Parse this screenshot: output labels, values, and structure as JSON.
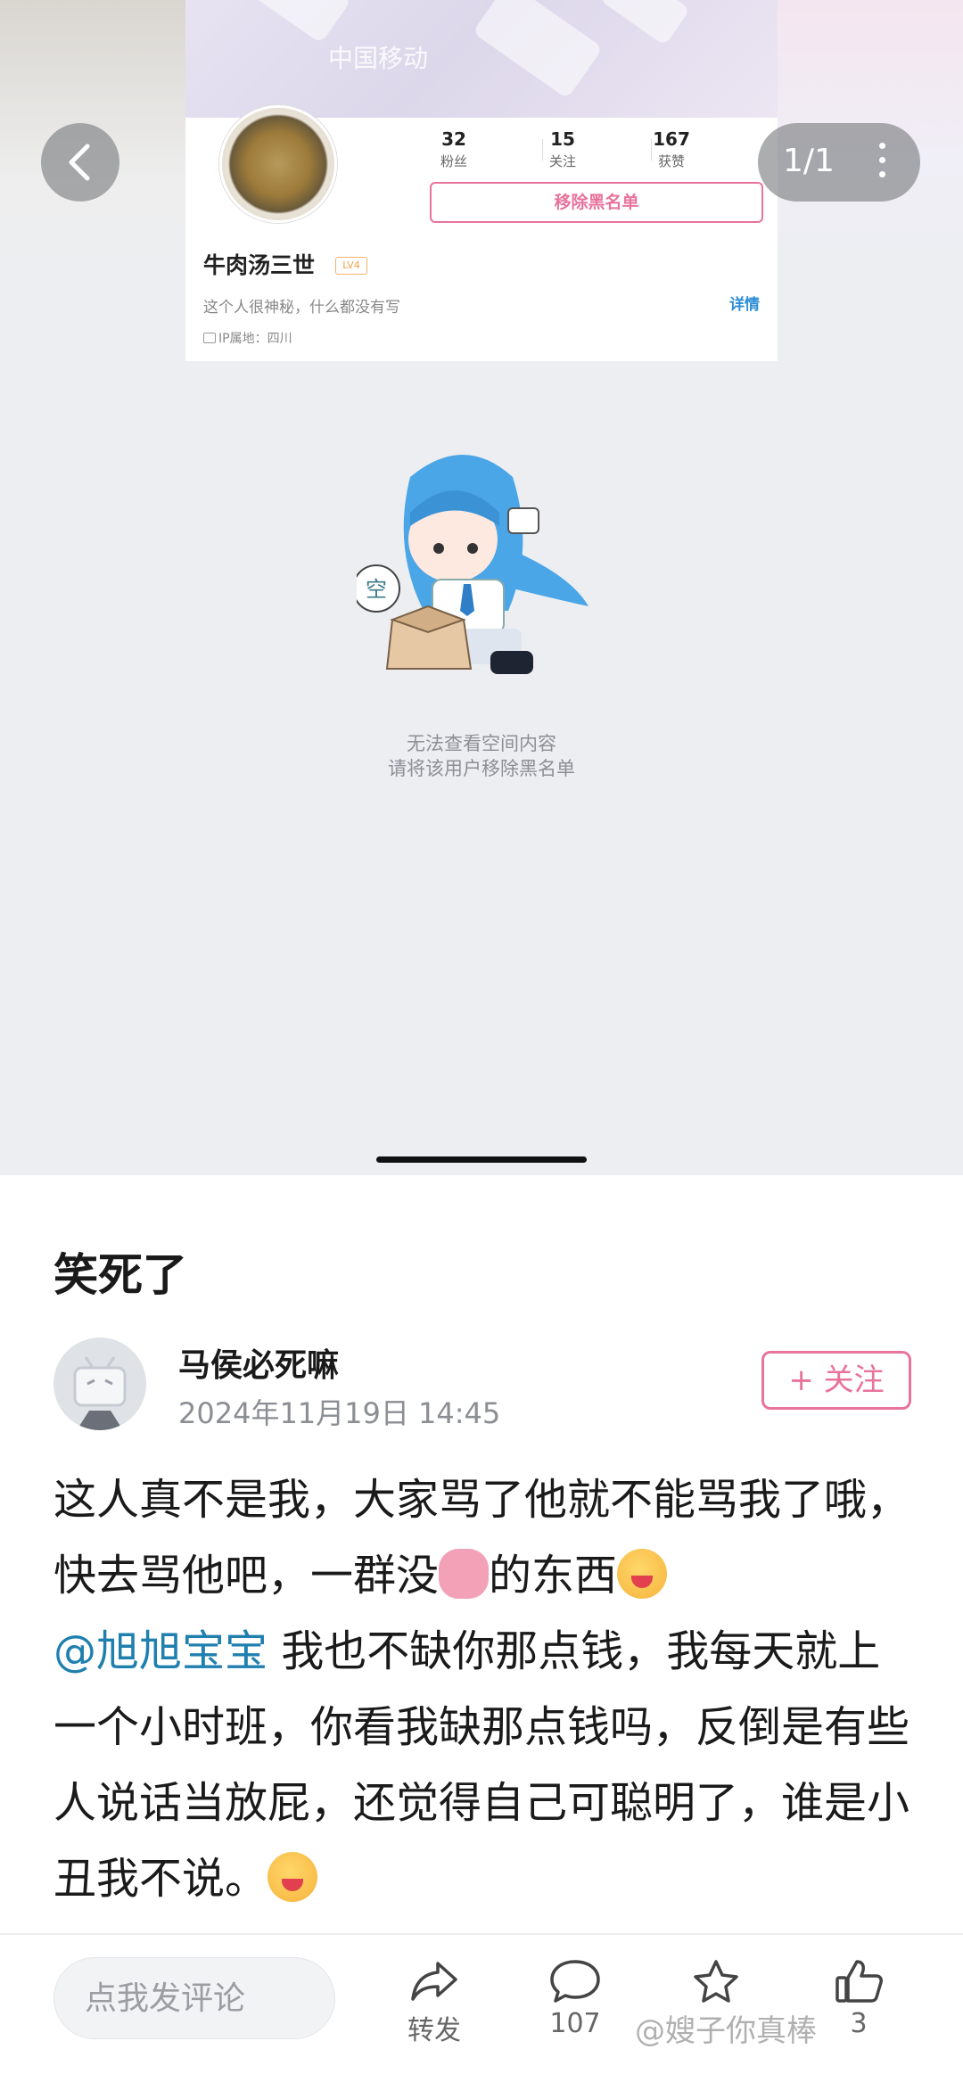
{
  "status_bar": {
    "carrier": "中国移动"
  },
  "viewer": {
    "page_indicator": "1/1"
  },
  "profile_card": {
    "stats": [
      {
        "value": "32",
        "label": "粉丝"
      },
      {
        "value": "15",
        "label": "关注"
      },
      {
        "value": "167",
        "label": "获赞"
      }
    ],
    "remove_blacklist_label": "移除黑名单",
    "username": "牛肉汤三世",
    "level_badge": "LV4",
    "bio": "这个人很神秘，什么都没有写",
    "detail_link": "详情",
    "ip_location": "IP属地：四川",
    "empty_mascot_bubble": "空",
    "empty_message_line1": "无法查看空间内容",
    "empty_message_line2": "请将该用户移除黑名单"
  },
  "post": {
    "title": "笑死了",
    "author": "马侯必死嘛",
    "timestamp": "2024年11月19日 14:45",
    "follow_label": "+ 关注",
    "body_part1": "这人真不是我，大家骂了他就不能骂我了哦，快去骂他吧，一群没",
    "body_part2": "的东西",
    "mention": "@旭旭宝宝",
    "body_part3": " 我也不缺你那点钱，我每天就上一个小时班，你看我缺那点钱吗，反倒是有些人说话当放屁，还觉得自己可聪明了，谁是小丑我不说。"
  },
  "bottom_bar": {
    "comment_placeholder": "点我发评论",
    "actions": [
      {
        "icon": "share-icon",
        "label": "转发"
      },
      {
        "icon": "comment-icon",
        "label": "107"
      },
      {
        "icon": "star-icon",
        "label": ""
      },
      {
        "icon": "like-icon",
        "label": "3"
      }
    ]
  },
  "watermark": "@嫂子你真棒"
}
